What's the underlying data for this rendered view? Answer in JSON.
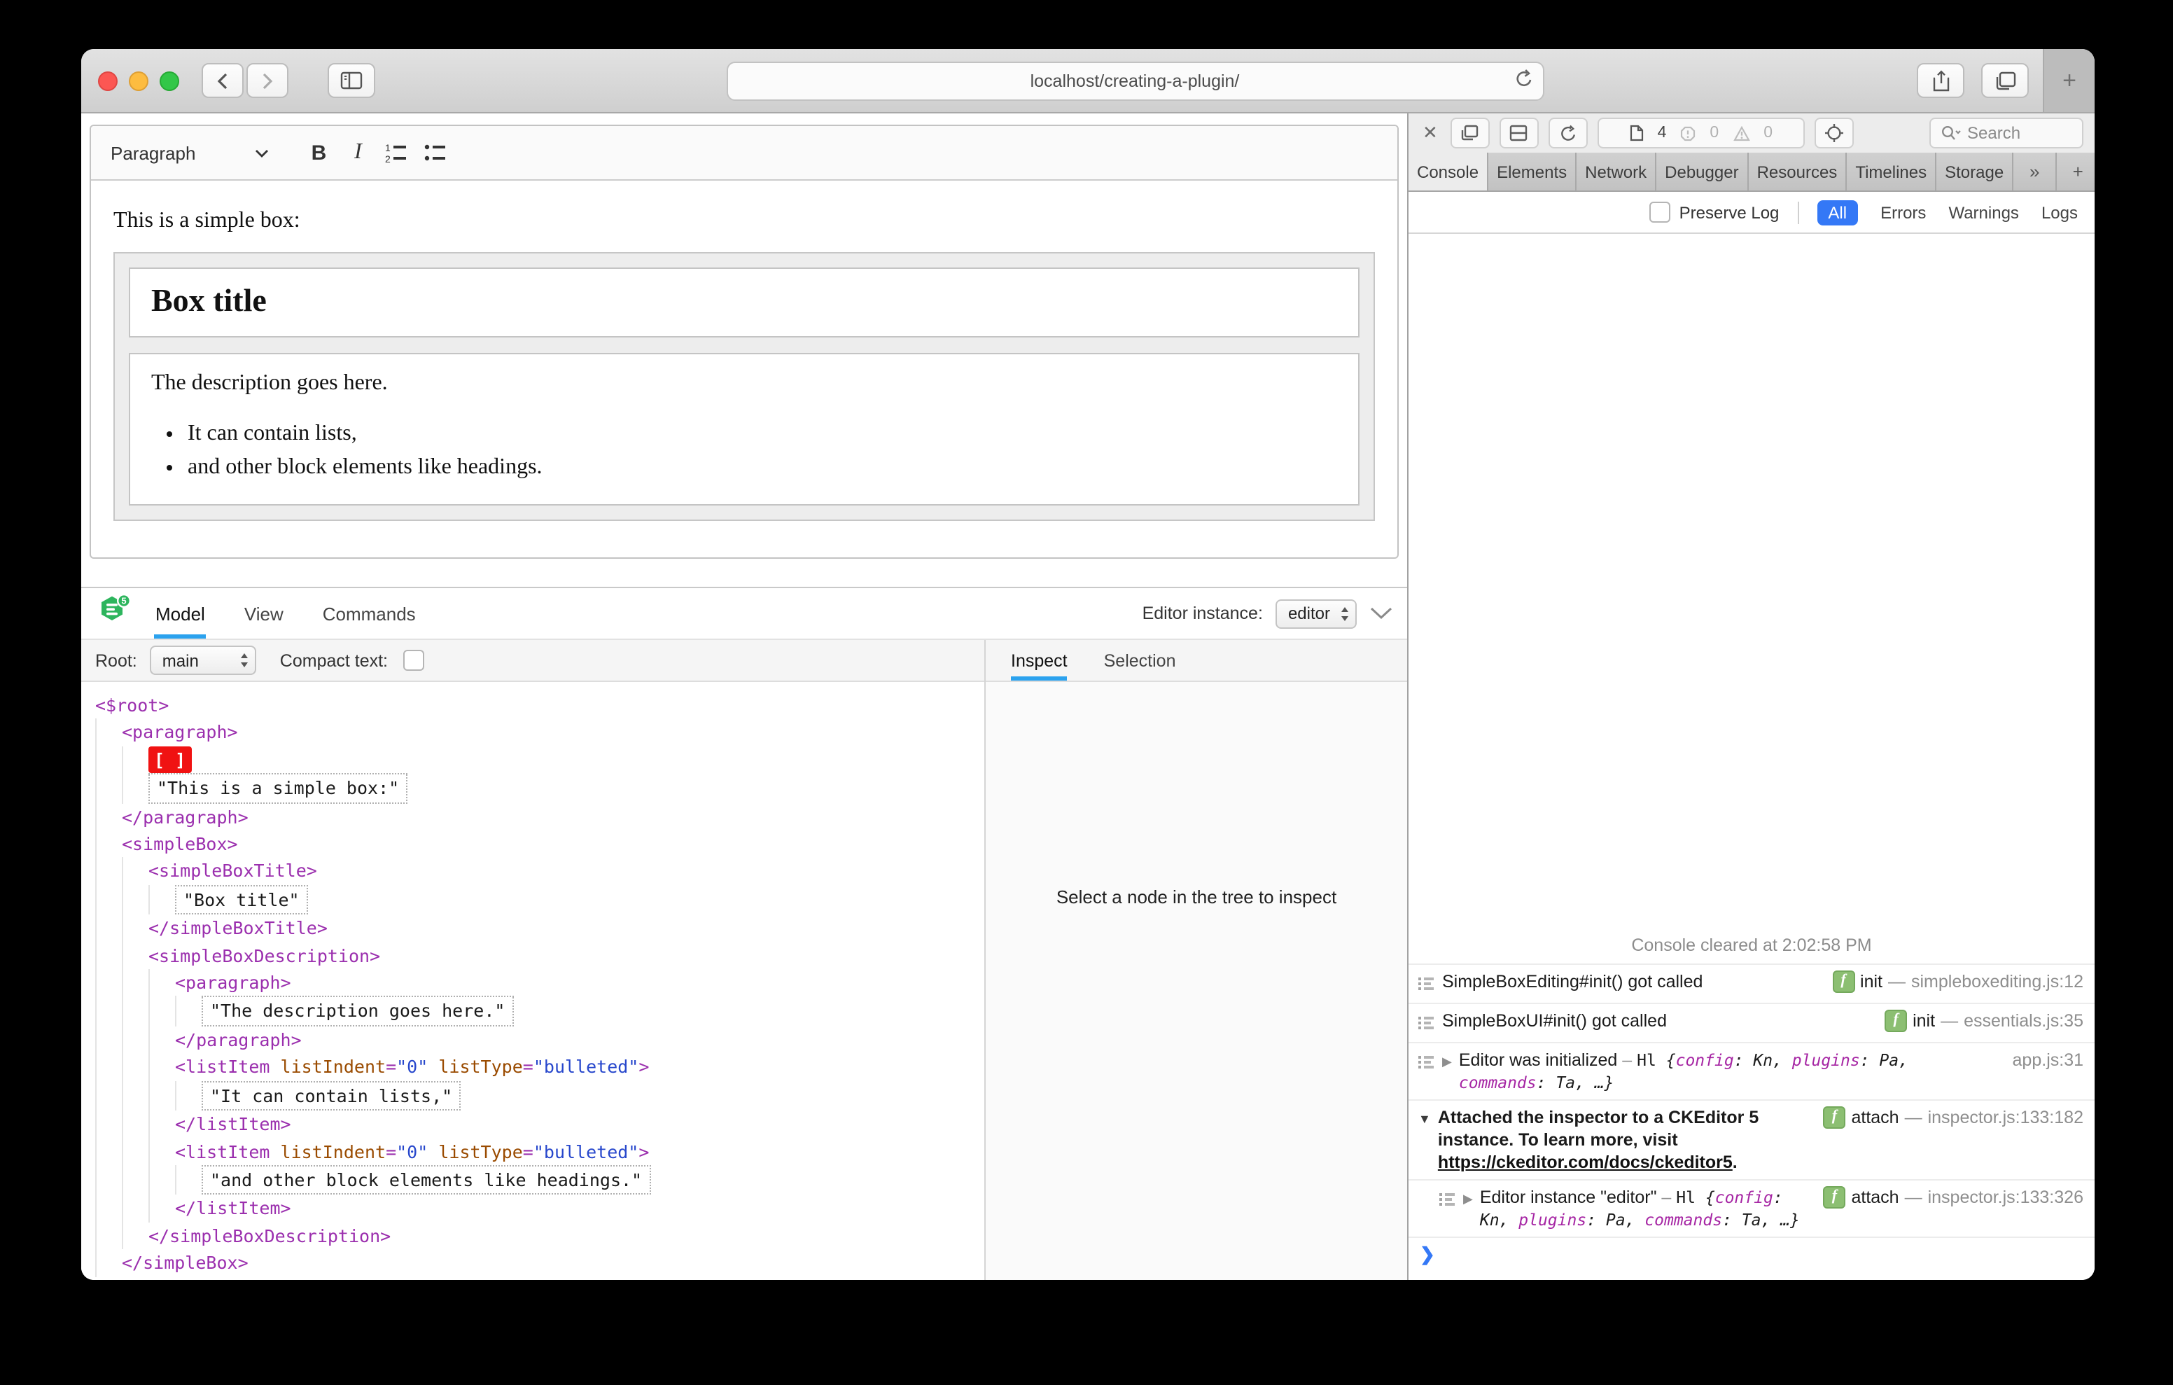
{
  "browser": {
    "url": "localhost/creating-a-plugin/",
    "new_tab_label": "+",
    "icons": [
      "back-chevron",
      "forward-chevron",
      "sidebar-toggle",
      "reload",
      "share",
      "tab-overview"
    ]
  },
  "colors": {
    "accent_blue_underline": "#2ba2ee",
    "filter_pill_blue": "#3478f6",
    "tag_purple": "#9b2fae",
    "attr_name_brown": "#9a4b00",
    "attr_value_blue": "#2747cc",
    "selection_red": "#f01212",
    "logo_green": "#2db55d",
    "badge_green": "#8cbf72"
  },
  "editor": {
    "toolbar": {
      "paragraph_label": "Paragraph",
      "bold_label": "B",
      "italic_label": "I"
    },
    "content": {
      "intro": "This is a simple box:",
      "box_title": "Box title",
      "description": "The description goes here.",
      "list_items": [
        "It can contain lists,",
        "and other block elements like headings."
      ]
    }
  },
  "inspector": {
    "tabs": [
      "Model",
      "View",
      "Commands"
    ],
    "active_tab": "Model",
    "editor_instance_label": "Editor instance:",
    "editor_instance_value": "editor",
    "root_label": "Root:",
    "root_value": "main",
    "compact_text_label": "Compact text:",
    "right_tabs": [
      "Inspect",
      "Selection"
    ],
    "active_right_tab": "Inspect",
    "empty_message": "Select a node in the tree to inspect",
    "tree": [
      {
        "i": 0,
        "t": "open",
        "tag": "$root"
      },
      {
        "i": 1,
        "t": "open",
        "tag": "paragraph"
      },
      {
        "i": 2,
        "t": "sel",
        "text": "[ ]"
      },
      {
        "i": 2,
        "t": "text",
        "text": "\"This is a simple box:\""
      },
      {
        "i": 1,
        "t": "close",
        "tag": "paragraph"
      },
      {
        "i": 1,
        "t": "open",
        "tag": "simpleBox"
      },
      {
        "i": 2,
        "t": "open",
        "tag": "simpleBoxTitle"
      },
      {
        "i": 3,
        "t": "text",
        "text": "\"Box title\""
      },
      {
        "i": 2,
        "t": "close",
        "tag": "simpleBoxTitle"
      },
      {
        "i": 2,
        "t": "open",
        "tag": "simpleBoxDescription"
      },
      {
        "i": 3,
        "t": "open",
        "tag": "paragraph"
      },
      {
        "i": 4,
        "t": "text",
        "text": "\"The description goes here.\""
      },
      {
        "i": 3,
        "t": "close",
        "tag": "paragraph"
      },
      {
        "i": 3,
        "t": "open",
        "tag": "listItem",
        "attrs": [
          [
            "listIndent",
            "\"0\""
          ],
          [
            "listType",
            "\"bulleted\""
          ]
        ]
      },
      {
        "i": 4,
        "t": "text",
        "text": "\"It can contain lists,\""
      },
      {
        "i": 3,
        "t": "close",
        "tag": "listItem"
      },
      {
        "i": 3,
        "t": "open",
        "tag": "listItem",
        "attrs": [
          [
            "listIndent",
            "\"0\""
          ],
          [
            "listType",
            "\"bulleted\""
          ]
        ]
      },
      {
        "i": 4,
        "t": "text",
        "text": "\"and other block elements like headings.\""
      },
      {
        "i": 3,
        "t": "close",
        "tag": "listItem"
      },
      {
        "i": 2,
        "t": "close",
        "tag": "simpleBoxDescription"
      },
      {
        "i": 1,
        "t": "close",
        "tag": "simpleBox"
      },
      {
        "i": 0,
        "t": "close",
        "tag": "$root"
      }
    ]
  },
  "devtools": {
    "toolbar": {
      "page_count": "4",
      "error_count": "0",
      "warning_count": "0",
      "search_placeholder": "Search",
      "close_label": "✕"
    },
    "tabs": [
      "Console",
      "Elements",
      "Network",
      "Debugger",
      "Resources",
      "Timelines",
      "Storage"
    ],
    "tab_icons": [
      "»",
      "+",
      "⚙"
    ],
    "active_tab": "Console",
    "filter": {
      "preserve_log_label": "Preserve Log",
      "scopes": [
        "All",
        "Errors",
        "Warnings",
        "Logs"
      ],
      "active_scope": "All"
    },
    "console": {
      "messages": [
        {
          "kind": "cleared",
          "text": "Console cleared at 2:02:58 PM"
        },
        {
          "kind": "log",
          "icon": true,
          "text": "SimpleBoxEditing#init() got called",
          "badge": "f",
          "fn": "init",
          "source": "simpleboxediting.js:12"
        },
        {
          "kind": "log",
          "icon": true,
          "text": "SimpleBoxUI#init() got called",
          "badge": "f",
          "fn": "init",
          "source": "essentials.js:35"
        },
        {
          "kind": "log",
          "icon": true,
          "disclosure": "closed",
          "text": "Editor was initialized",
          "obj": "Hl {config: Kn, plugins: Pa, commands: Ta, …}",
          "source": "app.js:31"
        },
        {
          "kind": "log",
          "icon": false,
          "disclosure": "open",
          "bold": true,
          "text": "Attached the inspector to a CKEditor 5 instance. To learn more, visit",
          "link": "https://ckeditor.com/docs/ckeditor5",
          "after_link": ".",
          "badge": "f",
          "fn": "attach",
          "source": "inspector.js:133:182"
        },
        {
          "kind": "log",
          "icon": true,
          "nested": true,
          "disclosure": "closed",
          "text": "Editor instance \"editor\"",
          "obj": "Hl {config: Kn, plugins: Pa, commands: Ta, …}",
          "badge": "f",
          "fn": "attach",
          "source": "inspector.js:133:326"
        }
      ],
      "prompt_glyph": "❯"
    }
  }
}
